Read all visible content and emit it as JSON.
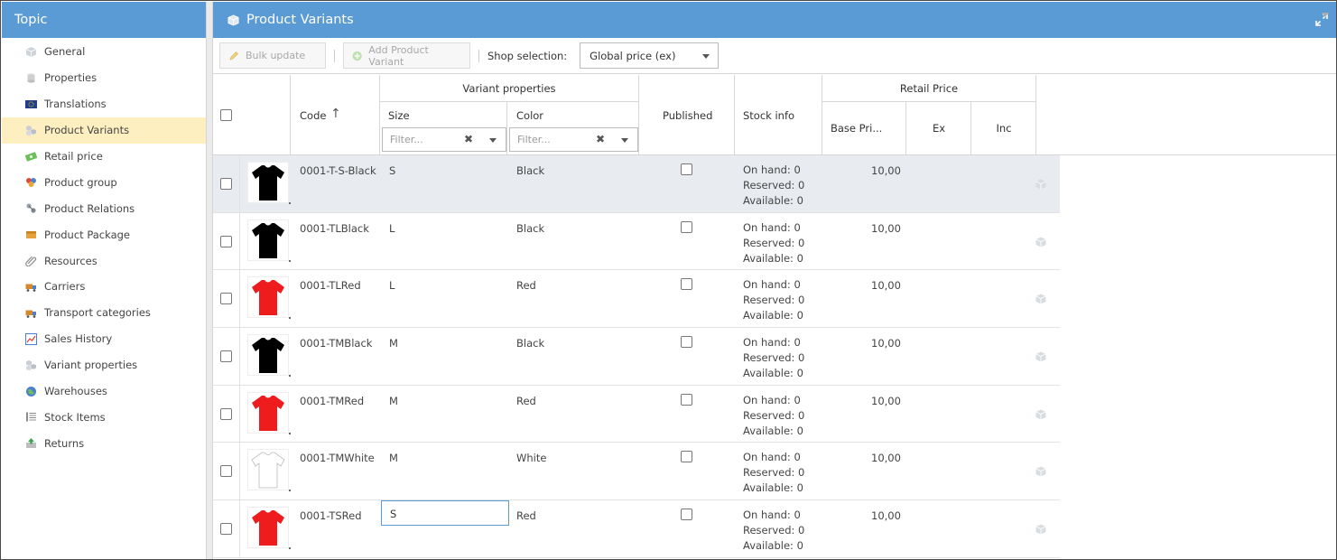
{
  "sidebar": {
    "title": "Topic",
    "items": [
      {
        "label": "General",
        "icon": "cube-icon"
      },
      {
        "label": "Properties",
        "icon": "cylinder-icon"
      },
      {
        "label": "Translations",
        "icon": "eu-flag-icon"
      },
      {
        "label": "Product Variants",
        "icon": "cubes-icon",
        "active": true
      },
      {
        "label": "Retail price",
        "icon": "money-icon"
      },
      {
        "label": "Product group",
        "icon": "group-icon"
      },
      {
        "label": "Product Relations",
        "icon": "relations-icon"
      },
      {
        "label": "Product Package",
        "icon": "package-icon"
      },
      {
        "label": "Resources",
        "icon": "paperclip-icon"
      },
      {
        "label": "Carriers",
        "icon": "truck-icon"
      },
      {
        "label": "Transport categories",
        "icon": "truck-icon"
      },
      {
        "label": "Sales History",
        "icon": "chart-icon"
      },
      {
        "label": "Variant properties",
        "icon": "cubes-icon"
      },
      {
        "label": "Warehouses",
        "icon": "globe-icon"
      },
      {
        "label": "Stock Items",
        "icon": "list-icon"
      },
      {
        "label": "Returns",
        "icon": "return-icon"
      }
    ]
  },
  "main": {
    "title": "Product Variants",
    "toolbar": {
      "bulk_update": "Bulk update",
      "add_variant": "Add Product Variant",
      "shop_label": "Shop selection:",
      "shop_value": "Global price (ex)"
    },
    "columns": {
      "code": "Code",
      "code_sort": "↑",
      "variant_properties": "Variant properties",
      "size": "Size",
      "color": "Color",
      "published": "Published",
      "stock_info": "Stock info",
      "retail_price": "Retail Price",
      "base_price": "Base Pri...",
      "ex": "Ex",
      "inc": "Inc",
      "filter_placeholder": "Filter..."
    },
    "rows": [
      {
        "code": "0001-T-S-Black",
        "size": "S",
        "color": "Black",
        "shirt_color": "#000000",
        "on_hand": "On hand: 0",
        "reserved": "Reserved: 0",
        "available": "Available: 0",
        "base_price": "10,00",
        "selected": true
      },
      {
        "code": "0001-TLBlack",
        "size": "L",
        "color": "Black",
        "shirt_color": "#000000",
        "on_hand": "On hand: 0",
        "reserved": "Reserved: 0",
        "available": "Available: 0",
        "base_price": "10,00"
      },
      {
        "code": "0001-TLRed",
        "size": "L",
        "color": "Red",
        "shirt_color": "#ee1c1c",
        "on_hand": "On hand: 0",
        "reserved": "Reserved: 0",
        "available": "Available: 0",
        "base_price": "10,00"
      },
      {
        "code": "0001-TMBlack",
        "size": "M",
        "color": "Black",
        "shirt_color": "#000000",
        "on_hand": "On hand: 0",
        "reserved": "Reserved: 0",
        "available": "Available: 0",
        "base_price": "10,00"
      },
      {
        "code": "0001-TMRed",
        "size": "M",
        "color": "Red",
        "shirt_color": "#ee1c1c",
        "on_hand": "On hand: 0",
        "reserved": "Reserved: 0",
        "available": "Available: 0",
        "base_price": "10,00"
      },
      {
        "code": "0001-TMWhite",
        "size": "M",
        "color": "White",
        "shirt_color": "#ffffff",
        "on_hand": "On hand: 0",
        "reserved": "Reserved: 0",
        "available": "Available: 0",
        "base_price": "10,00"
      },
      {
        "code": "0001-TSRed",
        "size": "S",
        "color": "Red",
        "shirt_color": "#ee1c1c",
        "on_hand": "On hand: 0",
        "reserved": "Reserved: 0",
        "available": "Available: 0",
        "base_price": "10,00",
        "editing_size": true
      }
    ]
  },
  "colors": {
    "header_blue": "#5b9bd5",
    "active_item": "#fdefc0",
    "selected_row": "#e8ecf0"
  }
}
